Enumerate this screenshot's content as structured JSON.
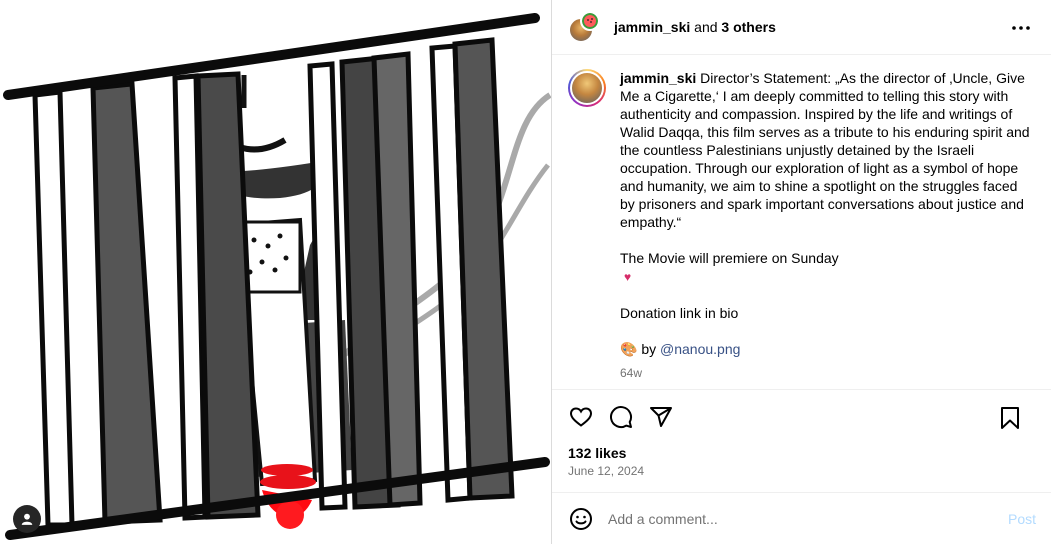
{
  "media": {
    "icons": {
      "user_tag": "person-icon"
    }
  },
  "header": {
    "username": "jammin_ski",
    "and_text": " and ",
    "others_text": "3 others",
    "icons": {
      "more": "more-dots-icon"
    }
  },
  "caption": {
    "username": "jammin_ski",
    "paragraphs": [
      "Director’s Statement: „As the director of ‚Uncle, Give Me a Cigarette,‘ I am deeply committed to telling this story with authenticity and compassion. Inspired by the life and writings of Walid Daqqa, this film serves as a tribute to his enduring spirit and the countless Palestinians unjustly detained by the Israeli occupation. Through our exploration of light as a symbol of hope and humanity, we aim to shine a spotlight on the struggles faced by prisoners and spark important conversations about justice and empathy.“",
      "The Movie will premiere on Sunday",
      "Donation link in bio"
    ],
    "heart_glyph": "♥",
    "credit_emoji": "🎨",
    "credit_by": " by ",
    "credit_mention": "@nanou.png",
    "age": "64w"
  },
  "actions": {
    "icons": {
      "like": "heart-icon",
      "comment": "comment-icon",
      "share": "share-icon",
      "save": "bookmark-icon"
    }
  },
  "likes": {
    "count_text": "132 likes",
    "date": "June 12, 2024"
  },
  "comment_bar": {
    "placeholder": "Add a comment...",
    "post_label": "Post",
    "icons": {
      "emoji": "emoji-icon"
    }
  },
  "colors": {
    "link": "#385185",
    "post_disabled": "#b3dbff",
    "muted": "#737373",
    "blood": "#e8121a"
  }
}
